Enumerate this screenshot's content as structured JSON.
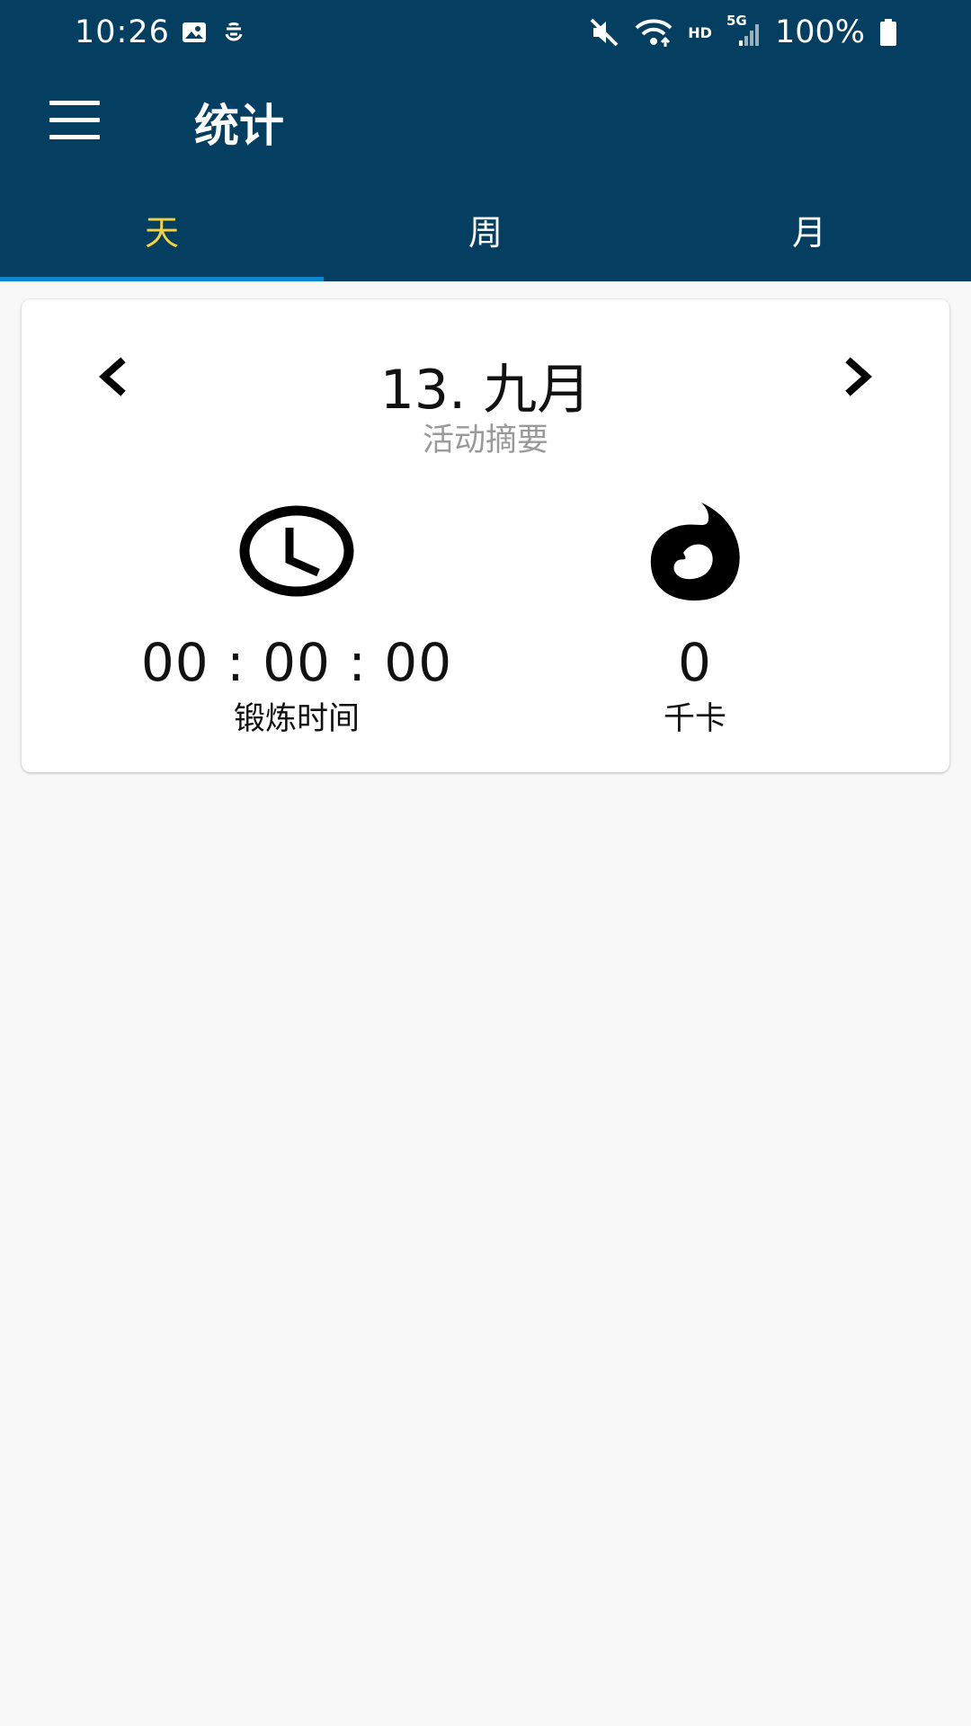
{
  "status_bar": {
    "time": "10:26",
    "battery_text": "100%",
    "network_label": "HD",
    "signal_label": "5G"
  },
  "toolbar": {
    "title": "统计"
  },
  "tabs": [
    {
      "label": "天",
      "active": true
    },
    {
      "label": "周",
      "active": false
    },
    {
      "label": "月",
      "active": false
    }
  ],
  "summary": {
    "date": "13. 九月",
    "subtitle": "活动摘要",
    "workout_time_value": "00 : 00 : 00",
    "workout_time_label": "锻炼时间",
    "calories_value": "0",
    "calories_label": "千卡"
  },
  "icons": {
    "menu": "hamburger-icon",
    "prev": "chevron-left-icon",
    "next": "chevron-right-icon",
    "workout_time": "clock-icon",
    "calories": "flame-icon"
  },
  "colors": {
    "app_bar": "#043f61",
    "active_tab_text": "#f4d23d",
    "tab_indicator": "#0b87cf",
    "background": "#f8f8f8",
    "card": "#ffffff"
  }
}
